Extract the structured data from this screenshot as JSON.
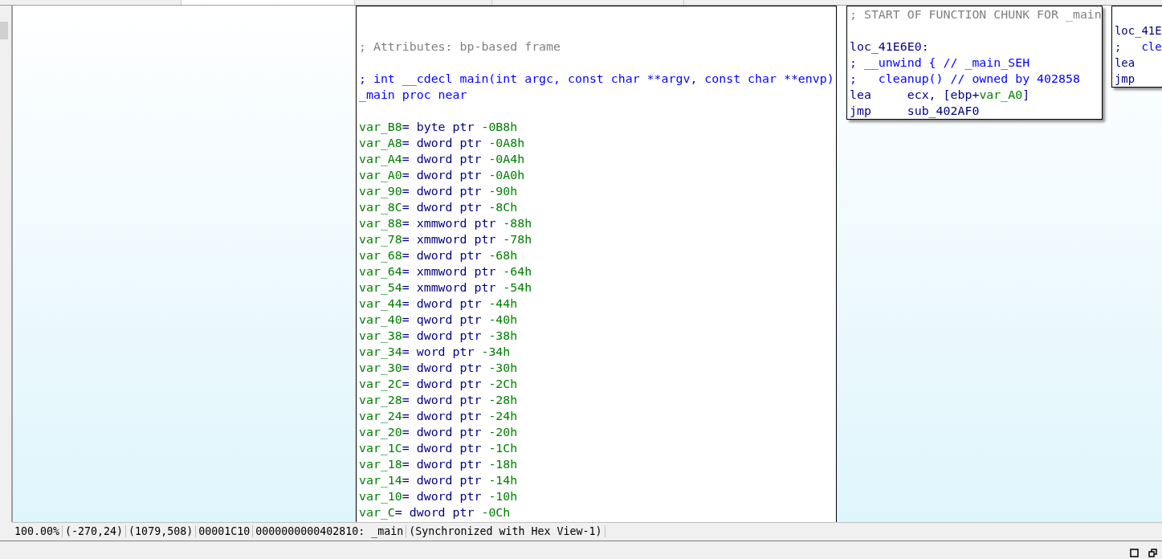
{
  "graph": {
    "nodes": [
      {
        "kind": "main",
        "lines": [
          {
            "segments": [
              {
                "text": "; Attributes: bp-based frame",
                "kind": "comment"
              }
            ]
          },
          {
            "gap_before": true,
            "segments": [
              {
                "text": "; int __cdecl main(int argc, const char **argv, const char **envp)",
                "kind": "proto"
              }
            ]
          },
          {
            "segments": [
              {
                "text": "_main proc near",
                "kind": "proto"
              }
            ]
          },
          {
            "gap_before": true,
            "segments": [
              {
                "text": "var_B8",
                "kind": "var"
              },
              {
                "text": "= byte ptr ",
                "kind": "code"
              },
              {
                "text": "-0B8h",
                "kind": "var"
              }
            ]
          },
          {
            "segments": [
              {
                "text": "var_A8",
                "kind": "var"
              },
              {
                "text": "= dword ptr ",
                "kind": "code"
              },
              {
                "text": "-0A8h",
                "kind": "var"
              }
            ]
          },
          {
            "segments": [
              {
                "text": "var_A4",
                "kind": "var"
              },
              {
                "text": "= dword ptr ",
                "kind": "code"
              },
              {
                "text": "-0A4h",
                "kind": "var"
              }
            ]
          },
          {
            "segments": [
              {
                "text": "var_A0",
                "kind": "var"
              },
              {
                "text": "= dword ptr ",
                "kind": "code"
              },
              {
                "text": "-0A0h",
                "kind": "var"
              }
            ]
          },
          {
            "segments": [
              {
                "text": "var_90",
                "kind": "var"
              },
              {
                "text": "= dword ptr ",
                "kind": "code"
              },
              {
                "text": "-90h",
                "kind": "var"
              }
            ]
          },
          {
            "segments": [
              {
                "text": "var_8C",
                "kind": "var"
              },
              {
                "text": "= dword ptr ",
                "kind": "code"
              },
              {
                "text": "-8Ch",
                "kind": "var"
              }
            ]
          },
          {
            "segments": [
              {
                "text": "var_88",
                "kind": "var"
              },
              {
                "text": "= xmmword ptr ",
                "kind": "code"
              },
              {
                "text": "-88h",
                "kind": "var"
              }
            ]
          },
          {
            "segments": [
              {
                "text": "var_78",
                "kind": "var"
              },
              {
                "text": "= xmmword ptr ",
                "kind": "code"
              },
              {
                "text": "-78h",
                "kind": "var"
              }
            ]
          },
          {
            "segments": [
              {
                "text": "var_68",
                "kind": "var"
              },
              {
                "text": "= dword ptr ",
                "kind": "code"
              },
              {
                "text": "-68h",
                "kind": "var"
              }
            ]
          },
          {
            "segments": [
              {
                "text": "var_64",
                "kind": "var"
              },
              {
                "text": "= xmmword ptr ",
                "kind": "code"
              },
              {
                "text": "-64h",
                "kind": "var"
              }
            ]
          },
          {
            "segments": [
              {
                "text": "var_54",
                "kind": "var"
              },
              {
                "text": "= xmmword ptr ",
                "kind": "code"
              },
              {
                "text": "-54h",
                "kind": "var"
              }
            ]
          },
          {
            "segments": [
              {
                "text": "var_44",
                "kind": "var"
              },
              {
                "text": "= dword ptr ",
                "kind": "code"
              },
              {
                "text": "-44h",
                "kind": "var"
              }
            ]
          },
          {
            "segments": [
              {
                "text": "var_40",
                "kind": "var"
              },
              {
                "text": "= qword ptr ",
                "kind": "code"
              },
              {
                "text": "-40h",
                "kind": "var"
              }
            ]
          },
          {
            "segments": [
              {
                "text": "var_38",
                "kind": "var"
              },
              {
                "text": "= dword ptr ",
                "kind": "code"
              },
              {
                "text": "-38h",
                "kind": "var"
              }
            ]
          },
          {
            "segments": [
              {
                "text": "var_34",
                "kind": "var"
              },
              {
                "text": "= word ptr ",
                "kind": "code"
              },
              {
                "text": "-34h",
                "kind": "var"
              }
            ]
          },
          {
            "segments": [
              {
                "text": "var_30",
                "kind": "var"
              },
              {
                "text": "= dword ptr ",
                "kind": "code"
              },
              {
                "text": "-30h",
                "kind": "var"
              }
            ]
          },
          {
            "segments": [
              {
                "text": "var_2C",
                "kind": "var"
              },
              {
                "text": "= dword ptr ",
                "kind": "code"
              },
              {
                "text": "-2Ch",
                "kind": "var"
              }
            ]
          },
          {
            "segments": [
              {
                "text": "var_28",
                "kind": "var"
              },
              {
                "text": "= dword ptr ",
                "kind": "code"
              },
              {
                "text": "-28h",
                "kind": "var"
              }
            ]
          },
          {
            "segments": [
              {
                "text": "var_24",
                "kind": "var"
              },
              {
                "text": "= dword ptr ",
                "kind": "code"
              },
              {
                "text": "-24h",
                "kind": "var"
              }
            ]
          },
          {
            "segments": [
              {
                "text": "var_20",
                "kind": "var"
              },
              {
                "text": "= dword ptr ",
                "kind": "code"
              },
              {
                "text": "-20h",
                "kind": "var"
              }
            ]
          },
          {
            "segments": [
              {
                "text": "var_1C",
                "kind": "var"
              },
              {
                "text": "= dword ptr ",
                "kind": "code"
              },
              {
                "text": "-1Ch",
                "kind": "var"
              }
            ]
          },
          {
            "segments": [
              {
                "text": "var_18",
                "kind": "var"
              },
              {
                "text": "= dword ptr ",
                "kind": "code"
              },
              {
                "text": "-18h",
                "kind": "var"
              }
            ]
          },
          {
            "segments": [
              {
                "text": "var_14",
                "kind": "var"
              },
              {
                "text": "= dword ptr ",
                "kind": "code"
              },
              {
                "text": "-14h",
                "kind": "var"
              }
            ]
          },
          {
            "segments": [
              {
                "text": "var_10",
                "kind": "var"
              },
              {
                "text": "= dword ptr ",
                "kind": "code"
              },
              {
                "text": "-10h",
                "kind": "var"
              }
            ]
          },
          {
            "segments": [
              {
                "text": "var_C",
                "kind": "var"
              },
              {
                "text": "= dword ptr ",
                "kind": "code"
              },
              {
                "text": "-0Ch",
                "kind": "var"
              }
            ]
          }
        ]
      },
      {
        "kind": "chunk",
        "lines": [
          {
            "segments": [
              {
                "text": "; START OF FUNCTION CHUNK FOR _main",
                "kind": "comment"
              }
            ]
          },
          {
            "gap_before": true,
            "segments": [
              {
                "text": "loc_41E6E0:",
                "kind": "code"
              }
            ]
          },
          {
            "segments": [
              {
                "text": "; __unwind { // _main_SEH",
                "kind": "proto"
              }
            ]
          },
          {
            "segments": [
              {
                "text": ";   cleanup() // owned by 402858",
                "kind": "proto"
              }
            ]
          },
          {
            "segments": [
              {
                "text": "lea     ecx, [ebp+",
                "kind": "code"
              },
              {
                "text": "var_A0",
                "kind": "var"
              },
              {
                "text": "]",
                "kind": "code"
              }
            ]
          },
          {
            "segments": [
              {
                "text": "jmp     sub_402AF0",
                "kind": "code"
              }
            ]
          }
        ]
      },
      {
        "kind": "edge",
        "lines": [
          {
            "segments": [
              {
                "text": "loc_41E",
                "kind": "code"
              }
            ]
          },
          {
            "segments": [
              {
                "text": ";   cle",
                "kind": "proto"
              }
            ]
          },
          {
            "segments": [
              {
                "text": "lea",
                "kind": "code"
              }
            ]
          },
          {
            "segments": [
              {
                "text": "jmp",
                "kind": "code"
              }
            ]
          }
        ]
      }
    ]
  },
  "status_bar": [
    "100.00%",
    "(-270,24)",
    "(1079,508)",
    "00001C10",
    "0000000000402810: _main",
    "(Synchronized with Hex View-1)"
  ]
}
